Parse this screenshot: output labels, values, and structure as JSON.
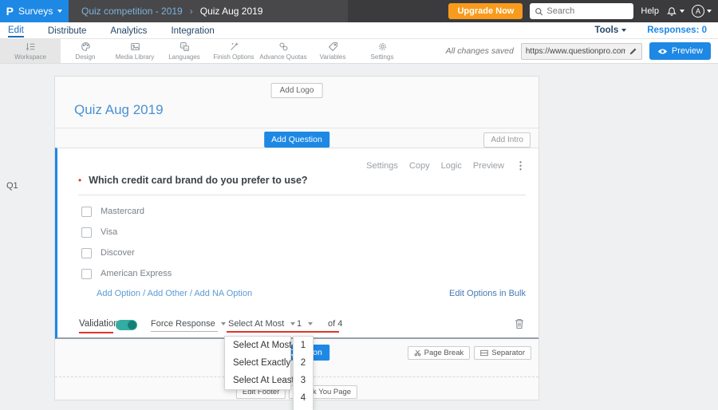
{
  "colors": {
    "topbar_dark": "#3b3b3d",
    "accent_blue": "#1e88e5",
    "upgrade_orange": "#f89b1c",
    "toggle_teal": "#33ada1",
    "underline_red": "#e0352b",
    "title_blue": "#4a90d2",
    "link_blue": "#5b9bd5"
  },
  "topbar": {
    "logo_letter": "P",
    "app_menu_label": "Surveys",
    "breadcrumb": {
      "parent": "Quiz competition - 2019",
      "separator": "›",
      "current": "Quiz Aug 2019"
    },
    "upgrade_label": "Upgrade Now",
    "search_placeholder": "Search",
    "help_label": "Help",
    "avatar_letter": "A"
  },
  "nav": {
    "items": [
      {
        "label": "Edit"
      },
      {
        "label": "Distribute"
      },
      {
        "label": "Analytics"
      },
      {
        "label": "Integration"
      }
    ],
    "tools_label": "Tools",
    "responses_label": "Responses: 0"
  },
  "toolbar": {
    "items": [
      {
        "label": "Workspace"
      },
      {
        "label": "Design"
      },
      {
        "label": "Media Library"
      },
      {
        "label": "Languages"
      },
      {
        "label": "Finish Options"
      },
      {
        "label": "Advance Quotas"
      },
      {
        "label": "Variables"
      },
      {
        "label": "Settings"
      }
    ],
    "saved_status": "All changes saved",
    "url": "https://www.questionpro.com/t/APNrFZ",
    "preview_label": "Preview"
  },
  "survey": {
    "question_number": "Q1",
    "add_logo_label": "Add Logo",
    "title": "Quiz Aug 2019",
    "add_question_label": "Add Question",
    "add_intro_label": "Add Intro",
    "question": {
      "actions": [
        {
          "label": "Settings"
        },
        {
          "label": "Copy"
        },
        {
          "label": "Logic"
        },
        {
          "label": "Preview"
        }
      ],
      "required_marker": "•",
      "text": "Which credit card brand do you prefer to use?",
      "options": [
        {
          "label": "Mastercard"
        },
        {
          "label": "Visa"
        },
        {
          "label": "Discover"
        },
        {
          "label": "American Express"
        }
      ],
      "links": {
        "add_option": "Add Option",
        "sep": "/",
        "add_other": "Add Other",
        "add_na": "Add NA Option"
      },
      "bulk_edit_label": "Edit Options in Bulk",
      "validation": {
        "label": "Validation",
        "force_label": "Force Response",
        "rule_value": "Select At Most",
        "count_value": "1",
        "of_label": "of 4"
      }
    },
    "footer": {
      "add_question_label": "Add Question",
      "page_break_label": "Page Break",
      "separator_label": "Separator",
      "edit_footer_label": "Edit Footer",
      "thank_you_label": "Thank You Page"
    }
  },
  "dropdowns": {
    "rule_options": [
      {
        "label": "Select At Most"
      },
      {
        "label": "Select Exactly"
      },
      {
        "label": "Select At Least"
      }
    ],
    "count_options": [
      {
        "label": "1"
      },
      {
        "label": "2"
      },
      {
        "label": "3"
      },
      {
        "label": "4"
      }
    ]
  }
}
